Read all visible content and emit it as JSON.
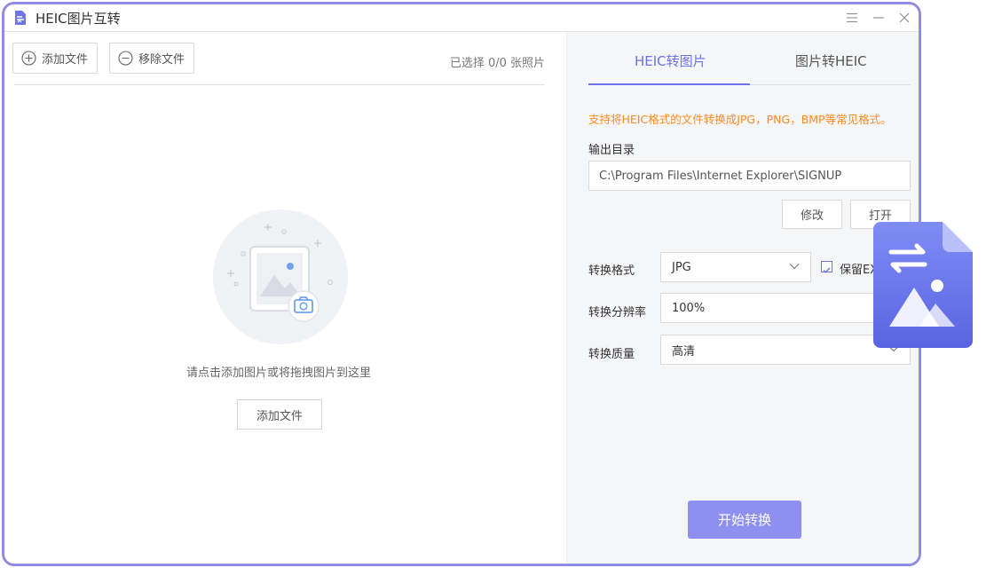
{
  "app": {
    "title": "HEIC图片互转"
  },
  "toolbar": {
    "add_label": "添加文件",
    "remove_label": "移除文件",
    "selected_count": "已选择 0/0 张照片"
  },
  "empty_state": {
    "hint": "请点击添加图片或将拖拽图片到这里",
    "add_button": "添加文件"
  },
  "tabs": [
    {
      "label": "HEIC转图片",
      "active": true
    },
    {
      "label": "图片转HEIC",
      "active": false
    }
  ],
  "settings": {
    "description": "支持将HEIC格式的文件转换成JPG，PNG，BMP等常见格式。",
    "output_dir_label": "输出目录",
    "output_dir_value": "C:\\Program Files\\Internet Explorer\\SIGNUP",
    "modify_button": "修改",
    "open_button": "打开",
    "format_label": "转换格式",
    "format_value": "JPG",
    "keep_exif_label": "保留EXIF",
    "keep_exif_checked": true,
    "resolution_label": "转换分辨率",
    "resolution_value": "100%",
    "quality_label": "转换质量",
    "quality_value": "高清",
    "start_button": "开始转换"
  },
  "colors": {
    "accent": "#6c72e8",
    "window_border": "#8f8ce8",
    "notice": "#ff8a1f",
    "start_button": "#8f8ff0"
  },
  "icons": [
    "app-file-icon",
    "menu-icon",
    "minimize-icon",
    "close-icon",
    "plus-circle-icon",
    "minus-circle-icon",
    "image-placeholder-icon",
    "camera-icon",
    "chevron-down-icon",
    "checkbox-icon",
    "heic-convert-badge-icon"
  ]
}
